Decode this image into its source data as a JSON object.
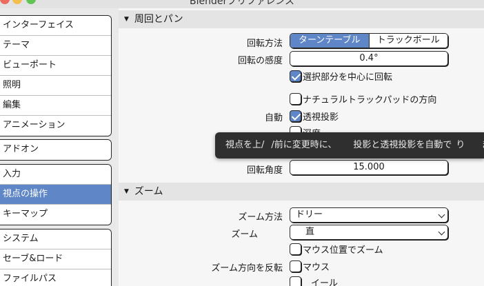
{
  "window": {
    "title": "Blenderプリファレンス"
  },
  "sidebar": {
    "groups": [
      {
        "items": [
          {
            "label": "インターフェイス"
          },
          {
            "label": "テーマ"
          },
          {
            "label": "ビューポート"
          },
          {
            "label": "照明"
          },
          {
            "label": "編集"
          },
          {
            "label": "アニメーション"
          }
        ]
      },
      {
        "items": [
          {
            "label": "アドオン"
          }
        ]
      },
      {
        "items": [
          {
            "label": "入力"
          },
          {
            "label": "視点の操作",
            "active": true
          },
          {
            "label": "キーマップ"
          }
        ]
      },
      {
        "items": [
          {
            "label": "システム"
          },
          {
            "label": "セーブ&ロード"
          },
          {
            "label": "ファイルパス"
          }
        ]
      }
    ]
  },
  "orbit": {
    "header": "周回とパン",
    "method_label": "回転方法",
    "method_options": [
      "ターンテーブル",
      "トラックボール"
    ],
    "method_selected": "ターンテーブル",
    "sensitivity_label": "回転の感度",
    "sensitivity_value": "0.4°",
    "orbit_selection_label": "選択部分を中心に回転",
    "orbit_selection_checked": true,
    "natural_trackpad_label": "ナチュラルトラックパッドの方向",
    "natural_trackpad_checked": false,
    "auto_label": "自動",
    "auto_perspective_label": "透視投影",
    "auto_perspective_checked": true,
    "depth_label": "深度",
    "rotation_angle_label": "回転角度",
    "rotation_angle_value": "15.000"
  },
  "tooltip": {
    "parts": [
      "視点を上/",
      "/前に変更時に、",
      "投影と透視投影を自動で",
      "り",
      "ます"
    ]
  },
  "zoom": {
    "header": "ズーム",
    "method_label": "ズーム方法",
    "method_value": "ドリー",
    "axis_label": "ズーム",
    "axis_value": "直",
    "zoom_to_mouse_label": "マウス位置でズーム",
    "invert_label": "ズーム方向を反転",
    "invert_mouse_label": "マウス",
    "invert_wheel_label": "イール"
  },
  "colors": {
    "accent": "#5f86c6",
    "tooltip_bg": "#2f2f2f"
  }
}
